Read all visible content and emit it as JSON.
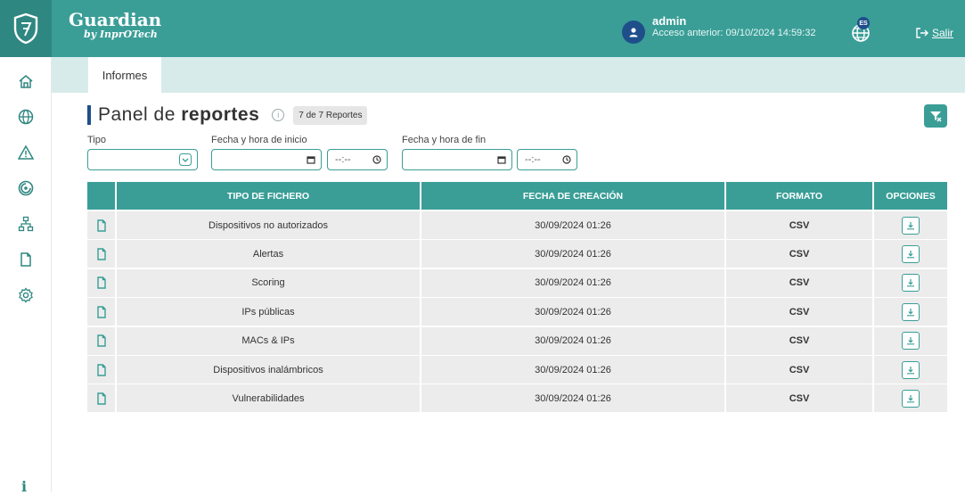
{
  "header": {
    "brand": "Guardian",
    "brand_sub": "by InprOTech",
    "user_name": "admin",
    "last_access": "Acceso anterior: 09/10/2024 14:59:32",
    "lang_badge": "ES",
    "logout_label": "Salir"
  },
  "sidebar": {
    "items": [
      "home-icon",
      "globe-icon",
      "alert-icon",
      "scan-icon",
      "network-icon",
      "file-icon",
      "settings-icon"
    ],
    "info": "i"
  },
  "tabs": [
    {
      "label": "Informes"
    }
  ],
  "panel": {
    "title_normal": "Panel de ",
    "title_bold": "reportes",
    "count_badge": "7 de 7 Reportes"
  },
  "filters": {
    "tipo_label": "Tipo",
    "start_label": "Fecha y hora de inicio",
    "end_label": "Fecha y hora de fin",
    "time_placeholder": "--:--"
  },
  "table": {
    "headers": [
      "TIPO DE FICHERO",
      "FECHA DE CREACIÓN",
      "FORMATO",
      "OPCIONES"
    ],
    "rows": [
      {
        "type": "Dispositivos no autorizados",
        "date": "30/09/2024 01:26",
        "format": "CSV"
      },
      {
        "type": "Alertas",
        "date": "30/09/2024 01:26",
        "format": "CSV"
      },
      {
        "type": "Scoring",
        "date": "30/09/2024 01:26",
        "format": "CSV"
      },
      {
        "type": "IPs públicas",
        "date": "30/09/2024 01:26",
        "format": "CSV"
      },
      {
        "type": "MACs & IPs",
        "date": "30/09/2024 01:26",
        "format": "CSV"
      },
      {
        "type": "Dispositivos inalámbricos",
        "date": "30/09/2024 01:26",
        "format": "CSV"
      },
      {
        "type": "Vulnerabilidades",
        "date": "30/09/2024 01:26",
        "format": "CSV"
      }
    ]
  },
  "colors": {
    "primary": "#3a9e97",
    "accent": "#1f4f8a",
    "tabstrip": "#d7ecea"
  }
}
